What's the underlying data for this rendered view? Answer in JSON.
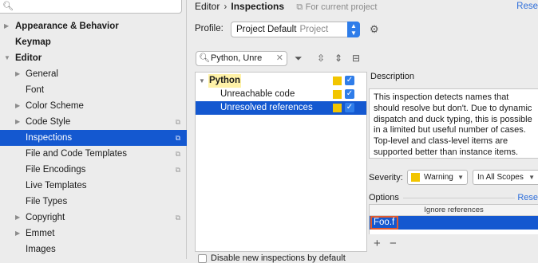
{
  "sidebar": {
    "search_value": "",
    "items": [
      {
        "label": "Appearance & Behavior",
        "arrow": "▶",
        "bold": true,
        "indent": 0
      },
      {
        "label": "Keymap",
        "arrow": "",
        "bold": true,
        "indent": 0
      },
      {
        "label": "Editor",
        "arrow": "▼",
        "bold": true,
        "indent": 0
      },
      {
        "label": "General",
        "arrow": "▶",
        "indent": 1
      },
      {
        "label": "Font",
        "arrow": "",
        "indent": 1
      },
      {
        "label": "Color Scheme",
        "arrow": "▶",
        "indent": 1
      },
      {
        "label": "Code Style",
        "arrow": "▶",
        "indent": 1,
        "project": true
      },
      {
        "label": "Inspections",
        "arrow": "",
        "indent": 1,
        "project": true,
        "selected": true
      },
      {
        "label": "File and Code Templates",
        "arrow": "",
        "indent": 1,
        "project": true
      },
      {
        "label": "File Encodings",
        "arrow": "",
        "indent": 1,
        "project": true
      },
      {
        "label": "Live Templates",
        "arrow": "",
        "indent": 1
      },
      {
        "label": "File Types",
        "arrow": "",
        "indent": 1
      },
      {
        "label": "Copyright",
        "arrow": "▶",
        "indent": 1,
        "project": true
      },
      {
        "label": "Emmet",
        "arrow": "▶",
        "indent": 1
      },
      {
        "label": "Images",
        "arrow": "",
        "indent": 1
      }
    ]
  },
  "header": {
    "crumb_parent": "Editor",
    "crumb_sep": "›",
    "crumb_current": "Inspections",
    "current_project": "For current project",
    "reset": "Rese"
  },
  "profile": {
    "label": "Profile:",
    "value": "Project Default",
    "scope": "Project"
  },
  "filter": {
    "value": "Python, Unre"
  },
  "tree": [
    {
      "label": "Python",
      "highlight": true,
      "arrow": "▼"
    },
    {
      "label": "Unreachable code"
    },
    {
      "label": "Unresolved references",
      "selected": true
    }
  ],
  "description": {
    "title": "Description",
    "text": "This inspection detects names that should resolve but don't. Due to dynamic dispatch and duck typing, this is possible in a limited but useful number of cases. Top-level and class-level items are supported better than instance items."
  },
  "severity": {
    "label": "Severity:",
    "value": "Warning",
    "scope": "In All Scopes",
    "color": "#f2c500"
  },
  "options": {
    "label": "Options",
    "reset": "Rese",
    "column_header": "Ignore references",
    "cell_value": "Foo.f",
    "add": "+",
    "remove": "−"
  },
  "footer": {
    "disable_new": "Disable new inspections by default"
  },
  "colors": {
    "selection": "#1458d0",
    "accent": "#2f7de9",
    "link": "#2f6fdb",
    "highlight": "#fff2a8",
    "edit_border": "#e05a2f"
  }
}
